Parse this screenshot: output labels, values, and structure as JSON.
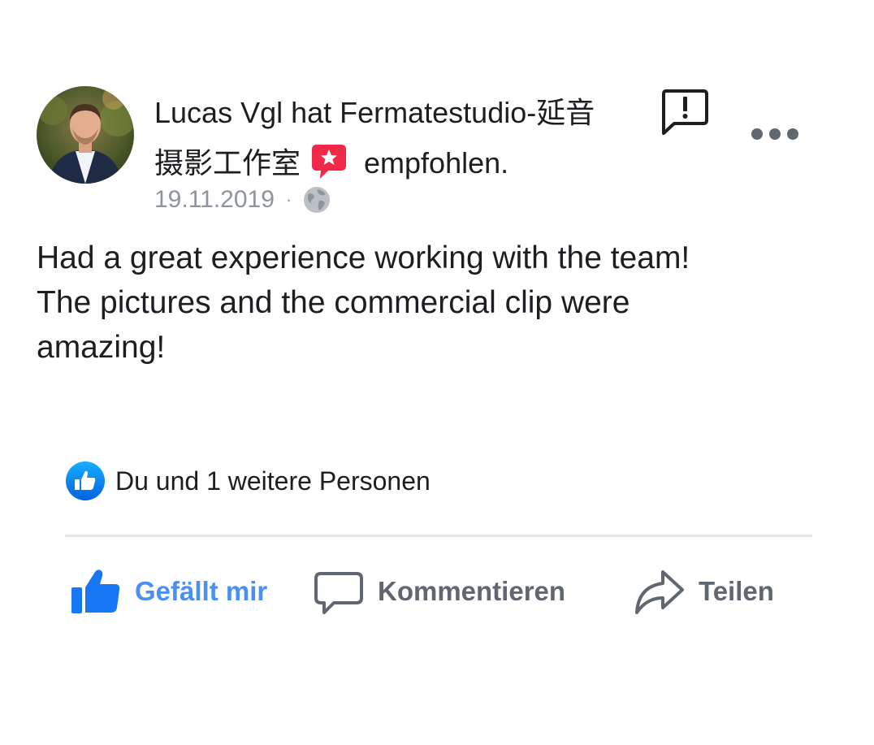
{
  "post": {
    "author_line1": "Lucas Vgl hat Fermatestudio-延音",
    "author_line2": "摄影工作室",
    "author_line2_suffix": "empfohlen.",
    "date": "19.11.2019",
    "separator": "·",
    "audience_icon": "globe-icon",
    "report_icon": "report-icon",
    "more_icon": "more-options-icon",
    "body": "Had a great experience working with the team!\nThe pictures and the commercial clip were\namazing!",
    "recommend_badge_color": "#f02849"
  },
  "reactions": {
    "icon": "like-reaction-icon",
    "icon_color": "#1877f2",
    "text": "Du und 1 weitere Personen"
  },
  "actions": {
    "like_label": "Gefällt mir",
    "like_color": "#4a90f2",
    "comment_label": "Kommentieren",
    "share_label": "Teilen",
    "neutral_color": "#606770"
  }
}
